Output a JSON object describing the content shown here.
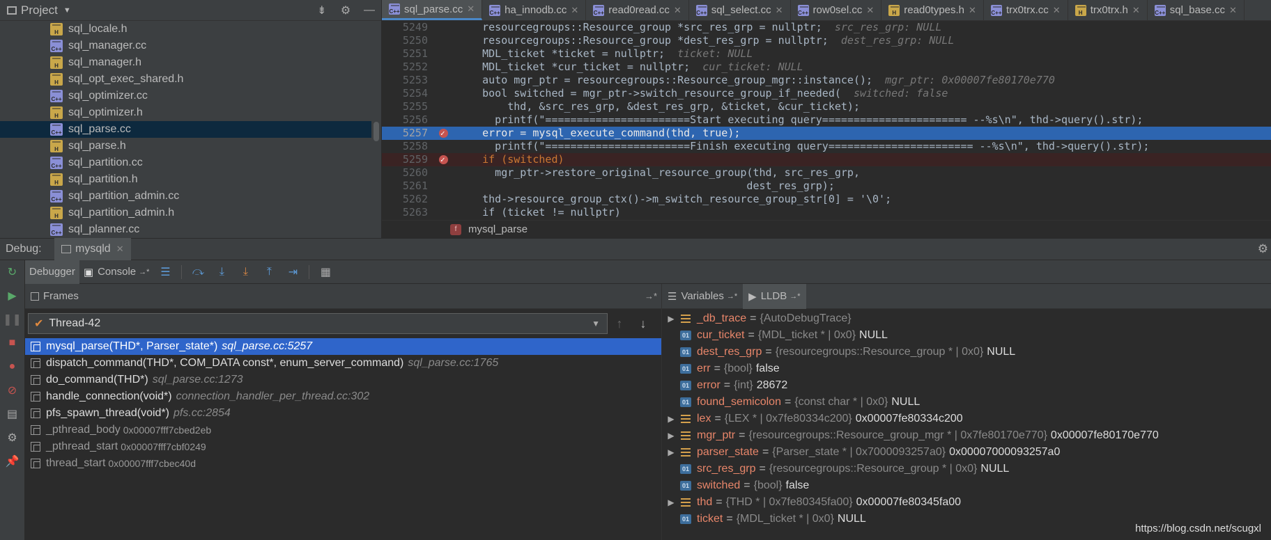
{
  "project": {
    "title": "Project",
    "files": [
      {
        "name": "sql_locale.h",
        "type": "h"
      },
      {
        "name": "sql_manager.cc",
        "type": "cc"
      },
      {
        "name": "sql_manager.h",
        "type": "h"
      },
      {
        "name": "sql_opt_exec_shared.h",
        "type": "h"
      },
      {
        "name": "sql_optimizer.cc",
        "type": "cc"
      },
      {
        "name": "sql_optimizer.h",
        "type": "h"
      },
      {
        "name": "sql_parse.cc",
        "type": "cc",
        "selected": true
      },
      {
        "name": "sql_parse.h",
        "type": "h"
      },
      {
        "name": "sql_partition.cc",
        "type": "cc"
      },
      {
        "name": "sql_partition.h",
        "type": "h"
      },
      {
        "name": "sql_partition_admin.cc",
        "type": "cc"
      },
      {
        "name": "sql_partition_admin.h",
        "type": "h"
      },
      {
        "name": "sql_planner.cc",
        "type": "cc"
      }
    ]
  },
  "editor": {
    "tabs": [
      {
        "name": "sql_parse.cc",
        "type": "cc",
        "active": true
      },
      {
        "name": "ha_innodb.cc",
        "type": "cc"
      },
      {
        "name": "read0read.cc",
        "type": "cc"
      },
      {
        "name": "sql_select.cc",
        "type": "cc"
      },
      {
        "name": "row0sel.cc",
        "type": "cc"
      },
      {
        "name": "read0types.h",
        "type": "h"
      },
      {
        "name": "trx0trx.cc",
        "type": "cc"
      },
      {
        "name": "trx0trx.h",
        "type": "h"
      },
      {
        "name": "sql_base.cc",
        "type": "cc"
      }
    ],
    "lines": [
      {
        "num": "5249",
        "code": "    resourcegroups::Resource_group *src_res_grp = nullptr;",
        "hint": "  src_res_grp: NULL"
      },
      {
        "num": "5250",
        "code": "    resourcegroups::Resource_group *dest_res_grp = nullptr;",
        "hint": "  dest_res_grp: NULL"
      },
      {
        "num": "5251",
        "code": "    MDL_ticket *ticket = nullptr;",
        "hint": "  ticket: NULL"
      },
      {
        "num": "5252",
        "code": "    MDL_ticket *cur_ticket = nullptr;",
        "hint": "  cur_ticket: NULL"
      },
      {
        "num": "5253",
        "code": "    auto mgr_ptr = resourcegroups::Resource_group_mgr::instance();",
        "hint": "  mgr_ptr: 0x00007fe80170e770"
      },
      {
        "num": "5254",
        "code": "    bool switched = mgr_ptr->switch_resource_group_if_needed(",
        "hint": "  switched: false"
      },
      {
        "num": "5255",
        "code": "        thd, &src_res_grp, &dest_res_grp, &ticket, &cur_ticket);",
        "hint": ""
      },
      {
        "num": "5256",
        "code": "      printf(\"=======================Start executing query======================= --%s\\n\", thd->query().str);",
        "hint": ""
      },
      {
        "num": "5257",
        "code": "    error = mysql_execute_command(thd, true);",
        "hint": "",
        "current": true,
        "breakpoint": true
      },
      {
        "num": "5258",
        "code": "      printf(\"=======================Finish executing query======================= --%s\\n\", thd->query().str);",
        "hint": ""
      },
      {
        "num": "5259",
        "code": "    if (switched)",
        "hint": "",
        "bpline": true,
        "breakpoint": true
      },
      {
        "num": "5260",
        "code": "      mgr_ptr->restore_original_resource_group(thd, src_res_grp,",
        "hint": ""
      },
      {
        "num": "5261",
        "code": "                                              dest_res_grp);",
        "hint": ""
      },
      {
        "num": "5262",
        "code": "    thd->resource_group_ctx()->m_switch_resource_group_str[0] = '\\0';",
        "hint": ""
      },
      {
        "num": "5263",
        "code": "    if (ticket != nullptr)",
        "hint": ""
      }
    ],
    "breadcrumb": "mysql_parse",
    "breadcrumb_badge": "f"
  },
  "debug": {
    "label": "Debug:",
    "session": "mysqld",
    "toolbar": {
      "debugger": "Debugger",
      "console": "Console"
    },
    "frames_title": "Frames",
    "thread": "Thread-42",
    "frames": [
      {
        "fn": "mysql_parse(THD*, Parser_state*)",
        "loc": "sql_parse.cc:5257",
        "selected": true
      },
      {
        "fn": "dispatch_command(THD*, COM_DATA const*, enum_server_command)",
        "loc": "sql_parse.cc:1765"
      },
      {
        "fn": "do_command(THD*)",
        "loc": "sql_parse.cc:1273"
      },
      {
        "fn": "handle_connection(void*)",
        "loc": "connection_handler_per_thread.cc:302"
      },
      {
        "fn": "pfs_spawn_thread(void*)",
        "loc": "pfs.cc:2854"
      },
      {
        "fn": "_pthread_body",
        "addr": "0x00007fff7cbed2eb",
        "dim": true
      },
      {
        "fn": "_pthread_start",
        "addr": "0x00007fff7cbf0249",
        "dim": true
      },
      {
        "fn": "thread_start",
        "addr": "0x00007fff7cbec40d",
        "dim": true
      }
    ],
    "vars_tab": "Variables",
    "lldb_tab": "LLDB",
    "variables": [
      {
        "name": "_db_trace",
        "type": "{AutoDebugTrace}",
        "value": "",
        "expandable": true,
        "kind": "obj"
      },
      {
        "name": "cur_ticket",
        "type": "{MDL_ticket * | 0x0}",
        "value": "NULL",
        "kind": "prim"
      },
      {
        "name": "dest_res_grp",
        "type": "{resourcegroups::Resource_group * | 0x0}",
        "value": "NULL",
        "kind": "prim"
      },
      {
        "name": "err",
        "type": "{bool}",
        "value": "false",
        "kind": "prim"
      },
      {
        "name": "error",
        "type": "{int}",
        "value": "28672",
        "kind": "prim"
      },
      {
        "name": "found_semicolon",
        "type": "{const char * | 0x0}",
        "value": "NULL",
        "kind": "prim"
      },
      {
        "name": "lex",
        "type": "{LEX * | 0x7fe80334c200}",
        "value": "0x00007fe80334c200",
        "expandable": true,
        "kind": "obj"
      },
      {
        "name": "mgr_ptr",
        "type": "{resourcegroups::Resource_group_mgr * | 0x7fe80170e770}",
        "value": "0x00007fe80170e770",
        "expandable": true,
        "kind": "obj"
      },
      {
        "name": "parser_state",
        "type": "{Parser_state * | 0x7000093257a0}",
        "value": "0x00007000093257a0",
        "expandable": true,
        "kind": "obj"
      },
      {
        "name": "src_res_grp",
        "type": "{resourcegroups::Resource_group * | 0x0}",
        "value": "NULL",
        "kind": "prim"
      },
      {
        "name": "switched",
        "type": "{bool}",
        "value": "false",
        "kind": "prim"
      },
      {
        "name": "thd",
        "type": "{THD * | 0x7fe80345fa00}",
        "value": "0x00007fe80345fa00",
        "expandable": true,
        "kind": "obj"
      },
      {
        "name": "ticket",
        "type": "{MDL_ticket * | 0x0}",
        "value": "NULL",
        "kind": "prim"
      }
    ]
  },
  "watermark": "https://blog.csdn.net/scugxl"
}
